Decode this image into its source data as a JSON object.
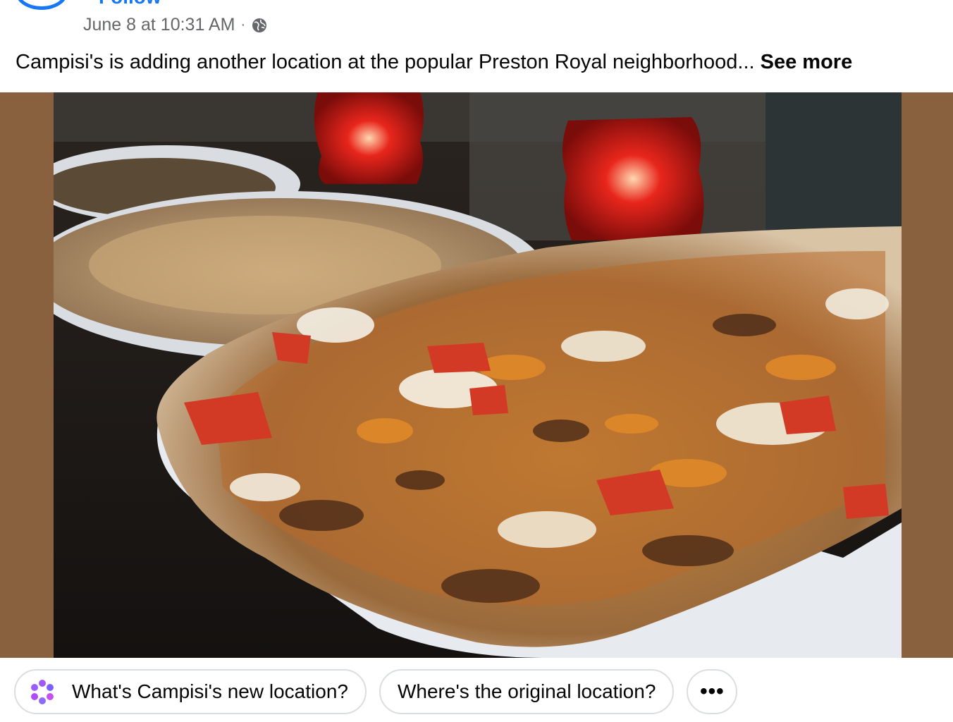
{
  "post": {
    "follow_label": "Follow",
    "timestamp": "June 8 at 10:31 AM",
    "separator": "·",
    "privacy_icon": "globe-icon",
    "caption_text": "Campisi's is adding another location at the popular Preston Royal neighborhood...",
    "see_more_label": "See more",
    "frame_color": "#8a613e"
  },
  "suggestions": {
    "icon": "sparkle-icon",
    "items": [
      "What's Campisi's new location?",
      "Where's the original location?"
    ],
    "more_label": "•••"
  }
}
